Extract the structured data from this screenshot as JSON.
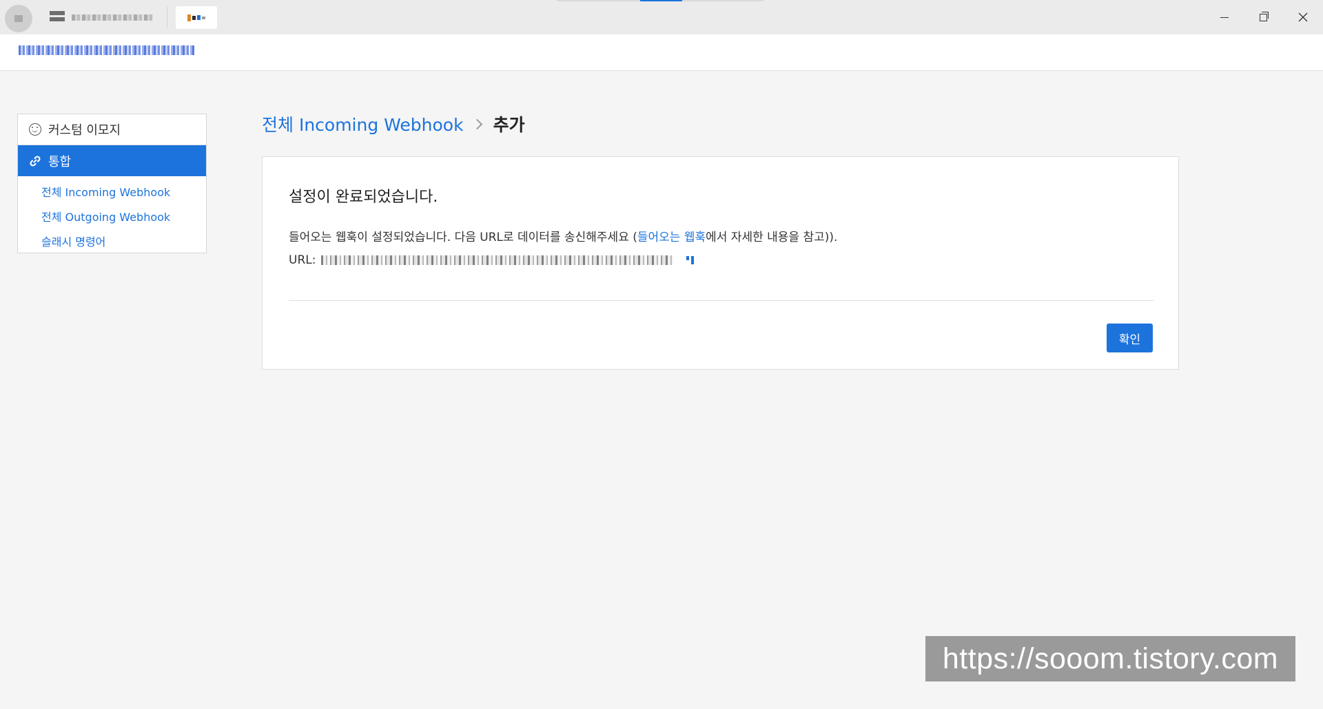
{
  "sidebar": {
    "items": [
      {
        "label": "커스텀 이모지",
        "icon": "smile-icon"
      },
      {
        "label": "통합",
        "icon": "link-icon",
        "active": true
      }
    ],
    "subitems": [
      {
        "label": "전체 Incoming Webhook"
      },
      {
        "label": "전체 Outgoing Webhook"
      },
      {
        "label": "슬래시 명령어"
      }
    ]
  },
  "breadcrumb": {
    "parent": "전체 Incoming Webhook",
    "current": "추가"
  },
  "panel": {
    "title": "설정이 완료되었습니다.",
    "desc_before": "들어오는 웹훅이 설정되었습니다. 다음 URL로 데이터를 송신해주세요 (",
    "desc_link": "들어오는 웹훅",
    "desc_after": "에서 자세한 내용을 참고)).",
    "url_label": "URL:",
    "ok_label": "확인"
  },
  "watermark": {
    "text": "https://sooom.tistory.com"
  },
  "colors": {
    "accent": "#1c73dc",
    "background": "#f5f5f5",
    "watermark_bg": "#9a9a9a"
  }
}
